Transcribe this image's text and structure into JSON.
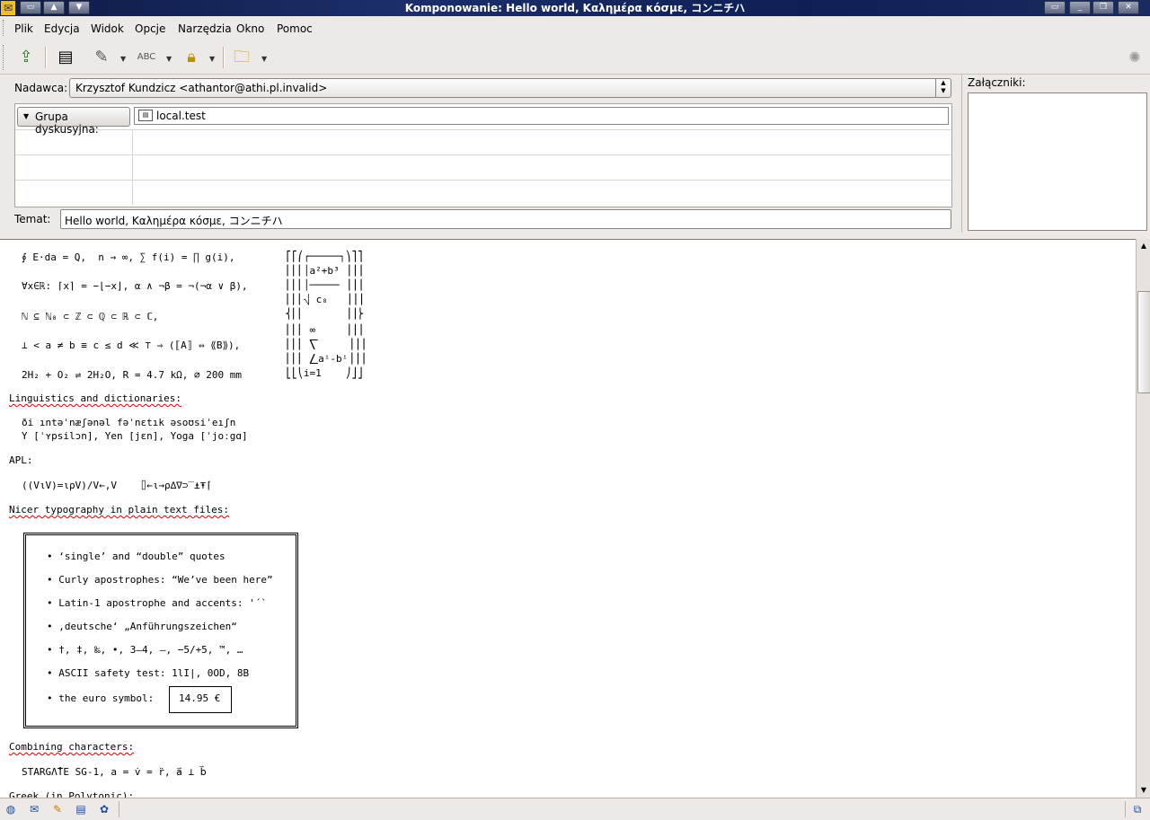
{
  "window": {
    "title": "Komponowanie: Hello world, Καλημέρα κόσμε, コンニチハ"
  },
  "menu": [
    {
      "label": "Plik",
      "key": "P"
    },
    {
      "label": "Edycja",
      "key": "E"
    },
    {
      "label": "Widok",
      "key": "W"
    },
    {
      "label": "Opcje",
      "key": "O"
    },
    {
      "label": "Narzędzia",
      "key": "N"
    },
    {
      "label": "Okno",
      "key": "O"
    },
    {
      "label": "Pomoc",
      "key": "m"
    }
  ],
  "toolbar": {
    "send_icon": "send-icon",
    "contacts_icon": "address-book-icon",
    "attach_icon": "paperclip-icon",
    "spell_icon": "spellcheck-icon",
    "security_icon": "lock-icon",
    "save_icon": "folder-save-icon",
    "spell_text": "ABC"
  },
  "header": {
    "from_label": "Nadawca:",
    "from_value": "Krzysztof Kundzicz <athantor@athi.pl.invalid>",
    "group_button": "Grupa dyskusyjna:",
    "group_value": "local.test",
    "subject_label": "Temat:",
    "subject_value": "Hello world, Καλημέρα κόσμε, コンニチハ",
    "attachments_label": "Załączniki:"
  },
  "body": {
    "math1": "∮ E⋅da = Q,  n → ∞, ∑ f(i) = ∏ g(i),",
    "math2": "∀x∈ℝ: ⌈x⌉ = −⌊−x⌋, α ∧ ¬β = ¬(¬α ∨ β),",
    "math3": "ℕ ⊆ ℕ₀ ⊂ ℤ ⊂ ℚ ⊂ ℝ ⊂ ℂ,",
    "math4": "⊥ < a ≠ b ≡ c ≤ d ≪ ⊤ ⇒ (⟦A⟧ ⇔ ⟪B⟫),",
    "math5": "2H₂ + O₂ ⇌ 2H₂O, R = 4.7 kΩ, ⌀ 200 mm",
    "formula_lines": [
      "⎡⎡⎛┌─────┐⎞⎤⎤",
      "⎢⎢⎜│a²+b³ ⎟⎥⎥",
      "⎢⎢⎜│───── ⎟⎥⎥",
      "⎢⎢⎜⎷ c₈   ⎟⎥⎥",
      "⎨⎢⎜       ⎟⎥⎬",
      "⎢⎢⎜ ∞     ⎟⎥⎥",
      "⎢⎢⎜ ⎲     ⎟⎥⎥",
      "⎢⎢⎜ ⎳aⁱ-bⁱ⎟⎥⎥",
      "⎣⎣⎝i=1    ⎠⎦⎦"
    ],
    "ling_head": "Linguistics and dictionaries:",
    "ling1": "ði ıntəˈnæʃənəl fəˈnɛtık əsoʊsiˈeıʃn",
    "ling2": "Y [ˈʏpsilɔn], Yen [jɛn], Yoga [ˈjoːgɑ]",
    "apl_head": "APL:",
    "apl_line": "((V⍳V)=⍳⍴V)/V←,V    ⌷←⍳→⍴∆∇⊃‾⍎⍕⌈",
    "typo_head": "Nicer typography in plain text files:",
    "bullets": [
      "• ‘single’ and “double” quotes",
      "• Curly apostrophes: “We’ve been here”",
      "• Latin-1 apostrophe and accents: '´`",
      "• ‚deutsche‘ „Anführungszeichen“",
      "• †, ‡, ‰, •, 3–4, —, −5/+5, ™, …",
      "• ASCII safety test: 1lI|, 0OD, 8B",
      "• the euro symbol:"
    ],
    "euro_value": "14.95 €",
    "comb_head": "Combining characters:",
    "comb_line": "STARGΛ̊TE SG-1, a = v̇ = r̈, a⃑ ⊥ b⃑",
    "greek_head": "Greek (in Polytonic):"
  },
  "status_icons": [
    "navigator-icon",
    "mail-icon",
    "composer-icon",
    "addressbook-icon",
    "irc-icon",
    "offline-icon"
  ]
}
